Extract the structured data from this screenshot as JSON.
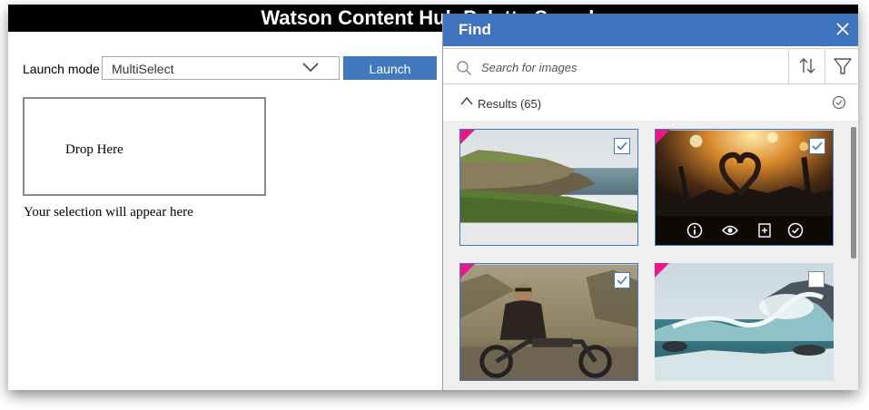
{
  "app": {
    "title": "Watson Content Hub Palette Sample"
  },
  "controls": {
    "launch_mode_label": "Launch mode :",
    "launch_mode_value": "MultiSelect",
    "launch_button": "Launch Palette",
    "drop_here": "Drop Here",
    "selection_text": "Your selection will appear here"
  },
  "palette": {
    "title": "Find",
    "search_placeholder": "Search for images",
    "results_label": "Results (65)",
    "tiles": [
      {
        "subject": "sea cliffs landscape",
        "selected": true
      },
      {
        "subject": "concert crowd hands heart",
        "selected": true,
        "actions": [
          "info-icon",
          "eye-icon",
          "add-to-collection-icon",
          "check-circle-icon"
        ]
      },
      {
        "subject": "man on motorcycle",
        "selected": true
      },
      {
        "subject": "ocean wave crashing on rocks",
        "selected": false
      }
    ]
  },
  "colors": {
    "accent": "#4178be",
    "header": "#3f73bf",
    "corner": "#e8178a",
    "topbar": "#000000"
  }
}
